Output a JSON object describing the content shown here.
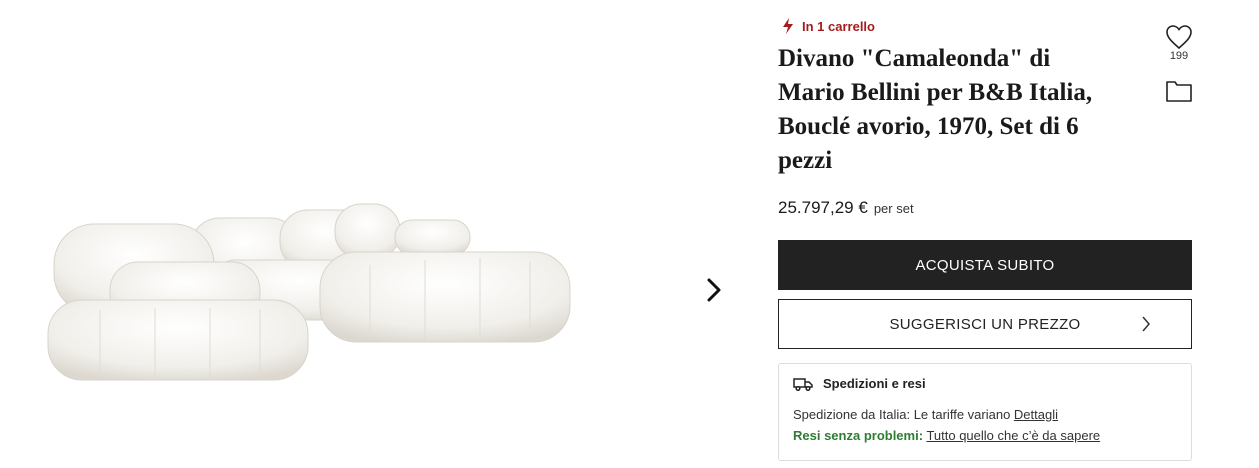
{
  "gallery": {
    "image_alt": "Divano Camaleonda bouclé avorio",
    "next_icon": "chevron-right-icon"
  },
  "product": {
    "cart_status": "In 1 carrello",
    "cart_icon": "lightning-icon",
    "title": "Divano \"Camaleonda\" di Mario Bellini per B&B Italia, Bouclé avorio, 1970, Set di 6 pezzi",
    "price": "25.797,29 €",
    "price_unit": "per set",
    "accent_color": "#a61c1c"
  },
  "actions": {
    "buy_label": "ACQUISTA SUBITO",
    "offer_label": "SUGGERISCI UN PREZZO",
    "favorite_count": "199"
  },
  "shipping": {
    "heading": "Spedizioni e resi",
    "line1_text": "Spedizione da Italia: Le tariffe variano",
    "line1_link": "Dettagli",
    "line2_label": "Resi senza problemi:",
    "line2_link": "Tutto quello che c’è da sapere"
  }
}
